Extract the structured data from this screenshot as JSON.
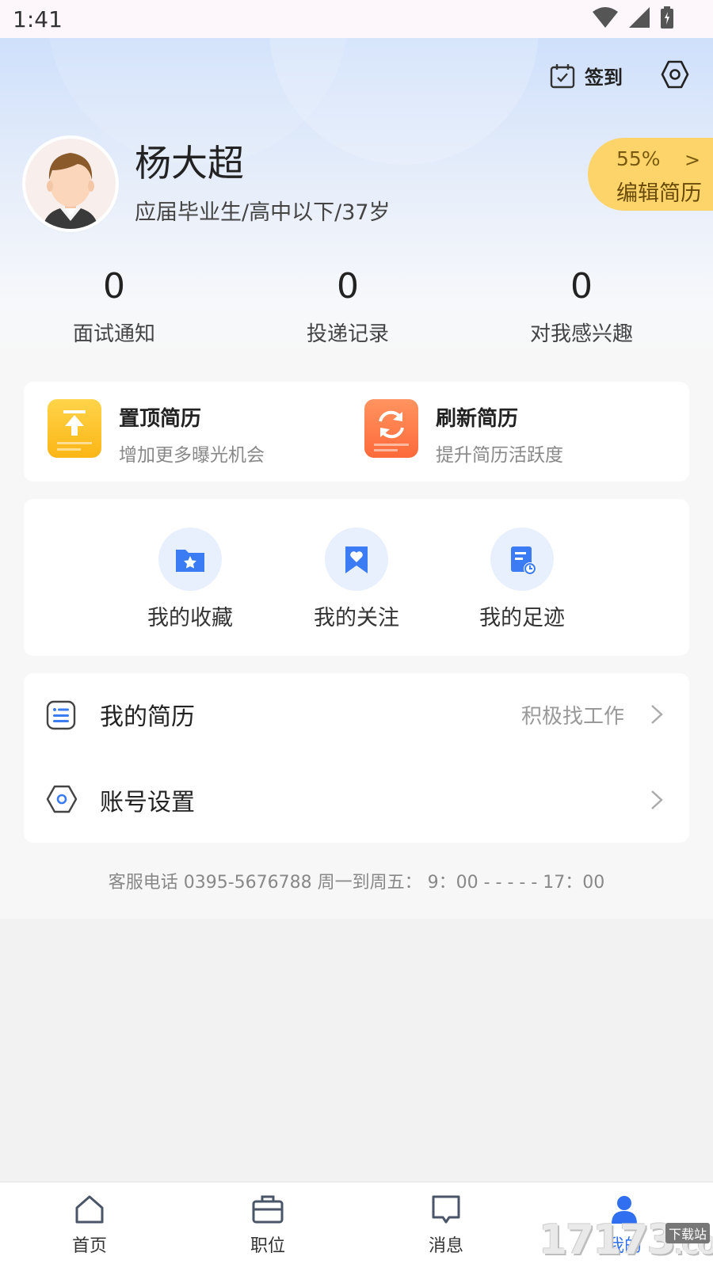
{
  "status_bar": {
    "time": "1:41"
  },
  "header": {
    "checkin_label": "签到",
    "user_name": "杨大超",
    "user_subtitle": "应届毕业生/高中以下/37岁",
    "resume_percent": "55%",
    "edit_resume_label": "编辑简历"
  },
  "stats": [
    {
      "value": "0",
      "label": "面试通知"
    },
    {
      "value": "0",
      "label": "投递记录"
    },
    {
      "value": "0",
      "label": "对我感兴趣"
    }
  ],
  "features": [
    {
      "title": "置顶简历",
      "subtitle": "增加更多曝光机会",
      "color": "#fdbd22"
    },
    {
      "title": "刷新简历",
      "subtitle": "提升简历活跃度",
      "color": "#ff7a49"
    }
  ],
  "quick_links": [
    {
      "label": "我的收藏",
      "icon": "folder-star-icon"
    },
    {
      "label": "我的关注",
      "icon": "bookmark-heart-icon"
    },
    {
      "label": "我的足迹",
      "icon": "history-doc-icon"
    }
  ],
  "menu": [
    {
      "label": "我的简历",
      "right_text": "积极找工作",
      "icon": "resume-list-icon"
    },
    {
      "label": "账号设置",
      "right_text": "",
      "icon": "settings-hex-icon"
    }
  ],
  "service_text": "客服电话 0395-5676788 周一到周五： 9：00 - - - - - 17：00",
  "tabs": [
    {
      "label": "首页",
      "icon": "home-icon"
    },
    {
      "label": "职位",
      "icon": "briefcase-icon"
    },
    {
      "label": "消息",
      "icon": "message-icon"
    },
    {
      "label": "我的",
      "icon": "user-icon",
      "active": true
    }
  ],
  "watermark": {
    "text": "17173",
    "suffix": ".COM",
    "badge": "下载站"
  },
  "colors": {
    "accent": "#3b7cf5",
    "pill": "#fcd46a",
    "tab_active": "#2f6ff0"
  }
}
